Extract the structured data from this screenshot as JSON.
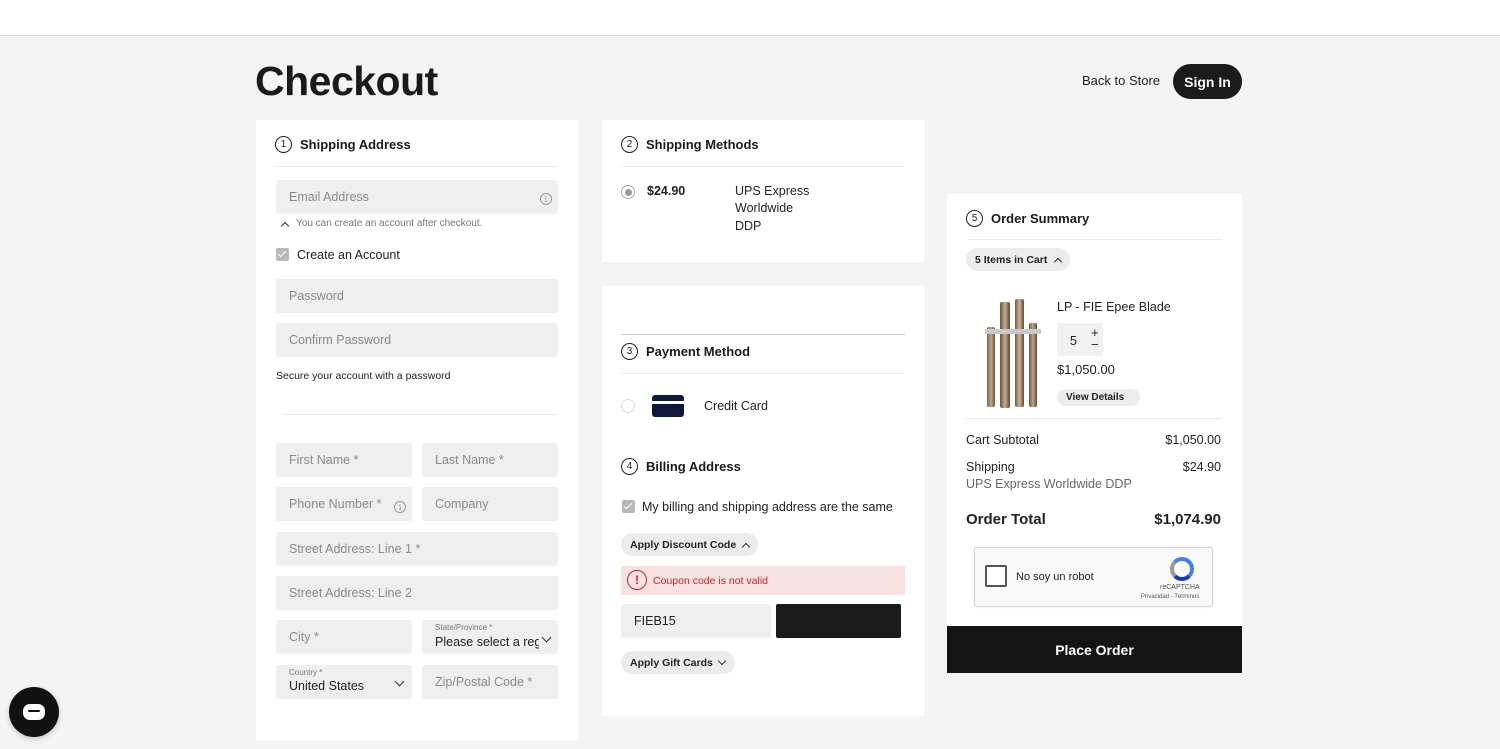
{
  "header": {
    "title": "Checkout",
    "back_link": "Back to Store",
    "sign_in": "Sign In"
  },
  "shipping_address": {
    "step": "1",
    "heading": "Shipping Address",
    "email_placeholder": "Email Address",
    "email_hint": "You can create an account after checkout.",
    "create_account_label": "Create an Account",
    "create_account_checked": true,
    "password_placeholder": "Password",
    "confirm_password_placeholder": "Confirm Password",
    "password_hint": "Secure your account with a password",
    "first_name": "First Name *",
    "last_name": "Last Name *",
    "phone": "Phone Number *",
    "company": "Company",
    "street1": "Street Address: Line 1 *",
    "street2": "Street Address: Line 2",
    "city": "City *",
    "state_label": "State/Province *",
    "state_value": "Please select a region",
    "country_label": "Country *",
    "country_value": "United States",
    "zip": "Zip/Postal Code *"
  },
  "shipping_methods": {
    "step": "2",
    "heading": "Shipping Methods",
    "options": [
      {
        "price": "$24.90",
        "name_line1": "UPS Express",
        "name_line2": "Worldwide",
        "name_line3": "DDP",
        "selected": true
      }
    ]
  },
  "payment_method": {
    "step": "3",
    "heading": "Payment Method",
    "option_label": "Credit Card"
  },
  "billing_address": {
    "step": "4",
    "heading": "Billing Address",
    "same_as_shipping_label": "My billing and shipping address are the same",
    "same_as_shipping_checked": true,
    "discount_toggle": "Apply Discount Code",
    "error_message": "Coupon code is not valid",
    "discount_value": "FIEB15",
    "gift_cards_toggle": "Apply Gift Cards"
  },
  "order_summary": {
    "step": "5",
    "heading": "Order Summary",
    "items_in_cart": "5 Items in Cart",
    "item": {
      "name": "LP - FIE Epee Blade",
      "qty": "5",
      "price": "$1,050.00",
      "details_toggle": "View Details"
    },
    "subtotal_label": "Cart Subtotal",
    "subtotal_value": "$1,050.00",
    "shipping_label": "Shipping",
    "shipping_value": "$24.90",
    "shipping_method": "UPS Express Worldwide DDP",
    "total_label": "Order Total",
    "total_value": "$1,074.90",
    "place_order": "Place Order"
  },
  "captcha": {
    "label": "No soy un robot",
    "brand": "reCAPTCHA",
    "links": "Privacidad - Términos"
  },
  "colors": {
    "accent": "#1a1a1a",
    "error": "#c1272d",
    "error_bg": "#f9e1e1",
    "field_bg": "#efefef"
  }
}
